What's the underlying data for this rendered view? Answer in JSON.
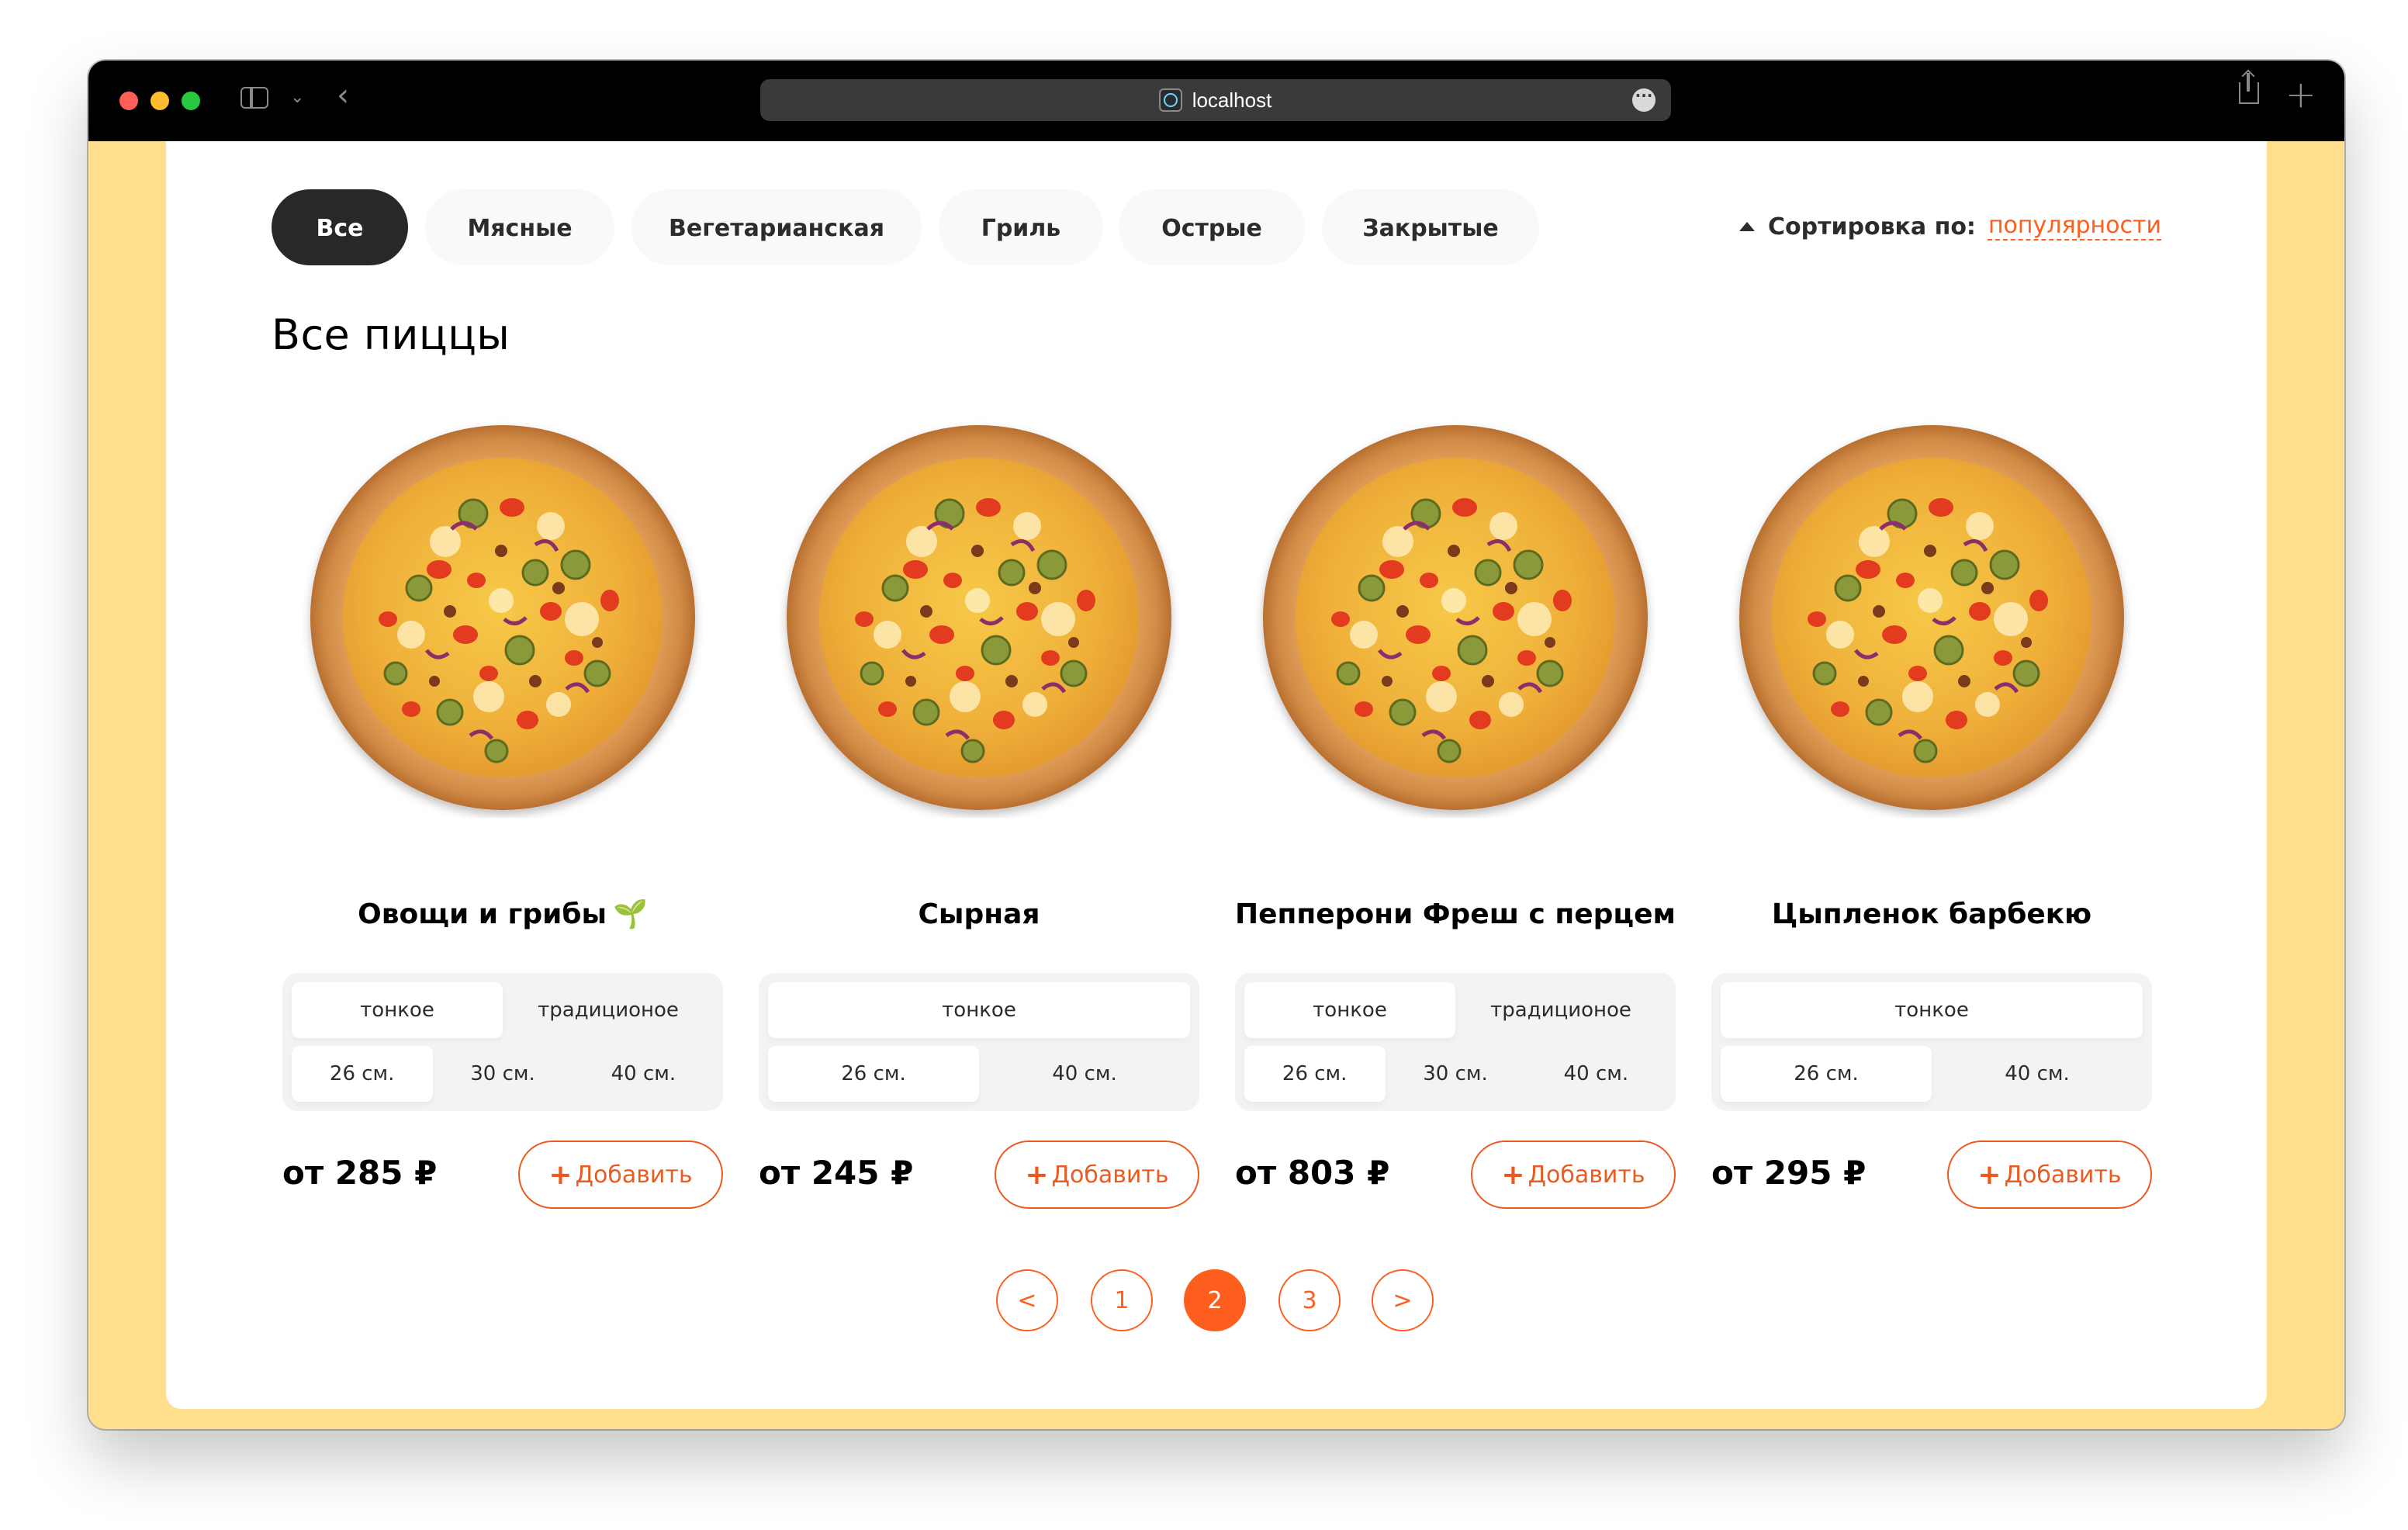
{
  "browser": {
    "url": "localhost"
  },
  "categories": [
    {
      "label": "Все",
      "active": true
    },
    {
      "label": "Мясные",
      "active": false
    },
    {
      "label": "Вегетарианская",
      "active": false
    },
    {
      "label": "Гриль",
      "active": false
    },
    {
      "label": "Острые",
      "active": false
    },
    {
      "label": "Закрытые",
      "active": false
    }
  ],
  "sort": {
    "label": "Сортировка по:",
    "value": "популярности"
  },
  "page_title": "Все пиццы",
  "pizzas": [
    {
      "title": "Овощи и грибы",
      "badge": "🌱",
      "dough": [
        {
          "label": "тонкое",
          "selected": true
        },
        {
          "label": "традиционое",
          "selected": false
        }
      ],
      "sizes": [
        {
          "label": "26 см.",
          "selected": true
        },
        {
          "label": "30 см.",
          "selected": false
        },
        {
          "label": "40 см.",
          "selected": false
        }
      ],
      "price": "от 285 ₽",
      "add_label": "Добавить",
      "add_icon": "+"
    },
    {
      "title": "Сырная",
      "badge": "",
      "dough": [
        {
          "label": "тонкое",
          "selected": true
        }
      ],
      "sizes": [
        {
          "label": "26 см.",
          "selected": true
        },
        {
          "label": "40 см.",
          "selected": false
        }
      ],
      "price": "от 245 ₽",
      "add_label": "Добавить",
      "add_icon": "+"
    },
    {
      "title": "Пепперони Фреш с перцем",
      "badge": "",
      "dough": [
        {
          "label": "тонкое",
          "selected": true
        },
        {
          "label": "традиционое",
          "selected": false
        }
      ],
      "sizes": [
        {
          "label": "26 см.",
          "selected": true
        },
        {
          "label": "30 см.",
          "selected": false
        },
        {
          "label": "40 см.",
          "selected": false
        }
      ],
      "price": "от 803 ₽",
      "add_label": "Добавить",
      "add_icon": "+"
    },
    {
      "title": "Цыпленок барбекю",
      "badge": "",
      "dough": [
        {
          "label": "тонкое",
          "selected": true
        }
      ],
      "sizes": [
        {
          "label": "26 см.",
          "selected": true
        },
        {
          "label": "40 см.",
          "selected": false
        }
      ],
      "price": "от 295 ₽",
      "add_label": "Добавить",
      "add_icon": "+"
    }
  ],
  "pagination": {
    "prev": "<",
    "next": ">",
    "pages": [
      "1",
      "2",
      "3"
    ],
    "current": "2"
  },
  "colors": {
    "accent": "#fe5f1e",
    "page_background": "#ffdf8c",
    "active_category": "#282828"
  }
}
